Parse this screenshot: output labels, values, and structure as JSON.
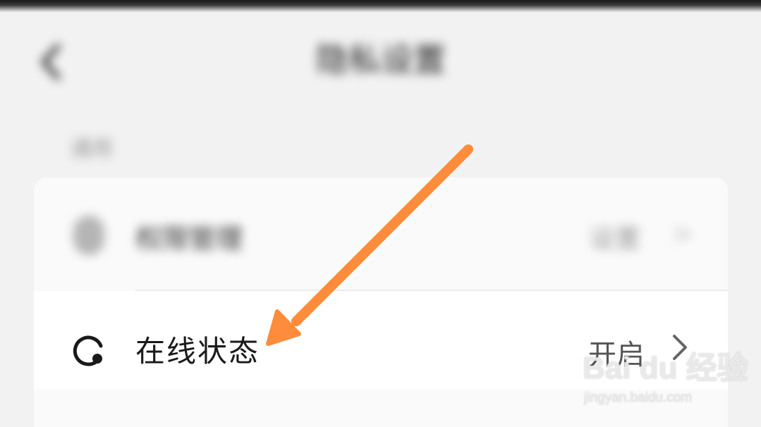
{
  "header": {
    "back_label": "<",
    "title": "隐私设置"
  },
  "section": {
    "title": "通用"
  },
  "rows": [
    {
      "label": "权限管理",
      "value": "设置",
      "chevron": ">",
      "icon": "shield-icon"
    },
    {
      "label": "在线状态",
      "value": "开启",
      "chevron": ">",
      "icon": "online-status-icon"
    }
  ],
  "annotation": {
    "arrow_color": "#ff8c3a",
    "icon": "arrow-annotation"
  },
  "watermark": {
    "logo": "Bai du 经验",
    "url": "jingyan.baidu.com"
  },
  "colors": {
    "background": "#f2f2f2",
    "card": "#fafafa",
    "highlight_row": "#ffffff",
    "text_primary": "#1a1a1a",
    "text_secondary": "#555555"
  }
}
